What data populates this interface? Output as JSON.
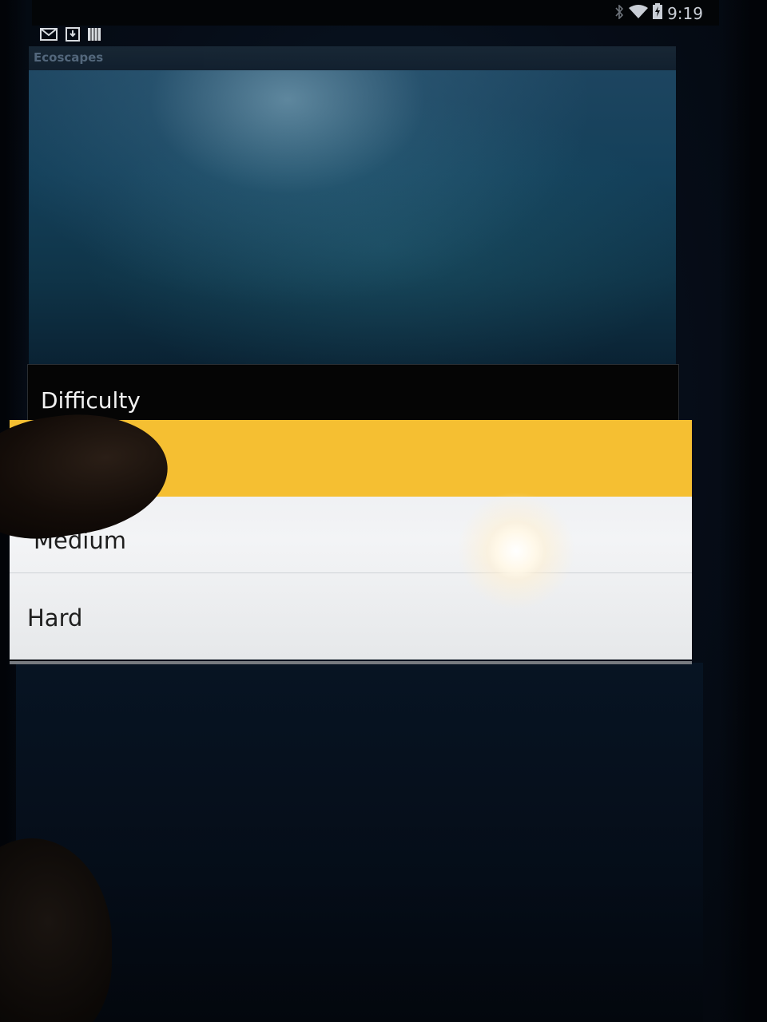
{
  "status_bar": {
    "time": "9:19",
    "icons": [
      "bluetooth-icon",
      "wifi-icon",
      "battery-charging-icon"
    ],
    "notification_icons": [
      "gmail-icon",
      "download-icon",
      "storage-icon"
    ]
  },
  "app": {
    "title": "Ecoscapes"
  },
  "dialog": {
    "title": "Difficulty",
    "options": [
      {
        "label": "",
        "selected": true
      },
      {
        "label": "Medium",
        "selected": false
      },
      {
        "label": "Hard",
        "selected": false
      }
    ],
    "accent_color": "#f5bf32"
  }
}
